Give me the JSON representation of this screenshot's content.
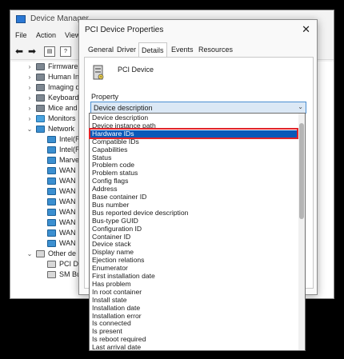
{
  "device_manager": {
    "title": "Device Manager",
    "menu": [
      "File",
      "Action",
      "View"
    ],
    "tree": [
      {
        "label": "Firmware",
        "icon": "firmware-icon",
        "expanded": false
      },
      {
        "label": "Human In",
        "icon": "hid-icon",
        "expanded": false
      },
      {
        "label": "Imaging d",
        "icon": "camera-icon",
        "expanded": false
      },
      {
        "label": "Keyboard",
        "icon": "keyboard-icon",
        "expanded": false
      },
      {
        "label": "Mice and",
        "icon": "mouse-icon",
        "expanded": false
      },
      {
        "label": "Monitors",
        "icon": "monitor-icon",
        "expanded": false
      },
      {
        "label": "Network",
        "icon": "network-icon",
        "expanded": true
      },
      {
        "label": "Intel(R",
        "icon": "network-adapter-icon",
        "child": true
      },
      {
        "label": "Intel(R",
        "icon": "network-adapter-icon",
        "child": true
      },
      {
        "label": "Marve",
        "icon": "network-adapter-icon",
        "child": true
      },
      {
        "label": "WAN",
        "icon": "network-adapter-icon",
        "child": true
      },
      {
        "label": "WAN",
        "icon": "network-adapter-icon",
        "child": true
      },
      {
        "label": "WAN",
        "icon": "network-adapter-icon",
        "child": true
      },
      {
        "label": "WAN",
        "icon": "network-adapter-icon",
        "child": true
      },
      {
        "label": "WAN",
        "icon": "network-adapter-icon",
        "child": true
      },
      {
        "label": "WAN",
        "icon": "network-adapter-icon",
        "child": true
      },
      {
        "label": "WAN",
        "icon": "network-adapter-icon",
        "child": true
      },
      {
        "label": "WAN",
        "icon": "network-adapter-icon",
        "child": true
      },
      {
        "label": "Other de",
        "icon": "other-devices-icon",
        "expanded": true
      },
      {
        "label": "PCI De",
        "icon": "unknown-device-icon",
        "child": true
      },
      {
        "label": "SM Bu",
        "icon": "unknown-device-icon",
        "child": true
      }
    ]
  },
  "dialog": {
    "title": "PCI Device Properties",
    "close": "✕",
    "tabs": [
      "General",
      "Driver",
      "Details",
      "Events",
      "Resources"
    ],
    "active_tab": "Details",
    "device_name": "PCI Device",
    "property_label": "Property",
    "property_value": "Device description"
  },
  "dropdown": {
    "selected": "Hardware IDs",
    "options": [
      "Device description",
      "Device instance path",
      "Hardware IDs",
      "Compatible IDs",
      "Capabilities",
      "Status",
      "Problem code",
      "Problem status",
      "Config flags",
      "Address",
      "Base container ID",
      "Bus number",
      "Bus reported device description",
      "Bus-type GUID",
      "Configuration ID",
      "Container ID",
      "Device stack",
      "Display name",
      "Ejection relations",
      "Enumerator",
      "First installation date",
      "Has problem",
      "In root container",
      "Install state",
      "Installation date",
      "Installation error",
      "Is connected",
      "Is present",
      "Is reboot required",
      "Last arrival date"
    ]
  },
  "colors": {
    "selection": "#0a58b8",
    "highlight_box": "#e0242a",
    "combo_bg": "#dbe8f5"
  }
}
